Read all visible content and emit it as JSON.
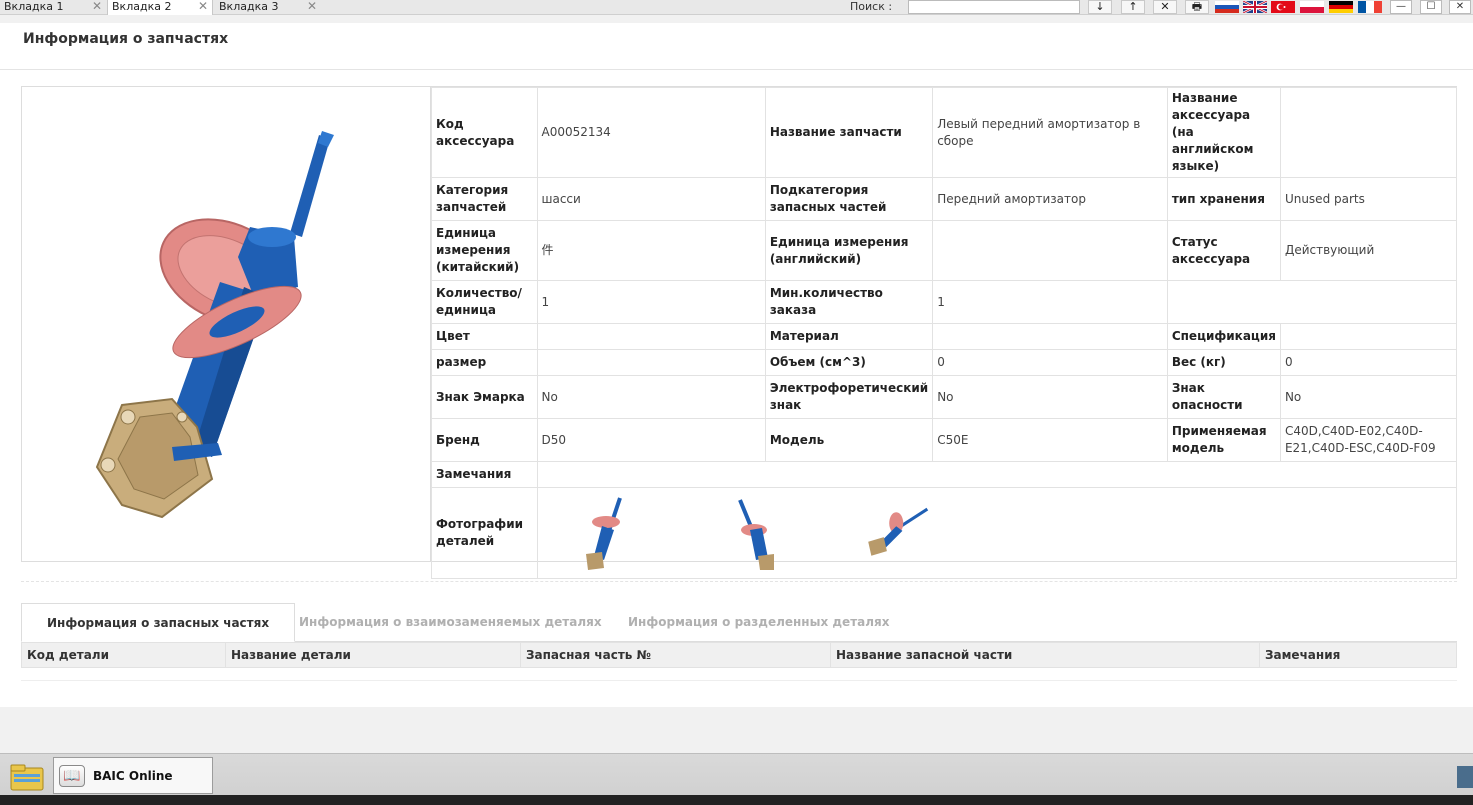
{
  "topbar": {
    "tabs": [
      {
        "label": "Вкладка 1"
      },
      {
        "label": "Вкладка 2"
      },
      {
        "label": "Вкладка 3"
      }
    ],
    "close_glyph": "✕",
    "search_label": "Поиск :",
    "search_value": "",
    "buttons": [
      "↓",
      "↑",
      "✕",
      "🖶"
    ],
    "flags": [
      "ru-flag",
      "gb-flag",
      "tr-flag",
      "pl-flag",
      "de-flag",
      "fr-flag"
    ],
    "window_buttons": [
      "—",
      "☐",
      "✕"
    ]
  },
  "page": {
    "title": "Информация о запчастях"
  },
  "info": {
    "code_label": "Код аксессуара",
    "code_value": "A00052134",
    "name_label": "Название запчасти",
    "name_value": "Левый передний амортизатор в сборе",
    "name_en_label": "Название аксессуара (на английском языке)",
    "name_en_value": "",
    "category_label": "Категория запчастей",
    "category_value": "шасси",
    "subcategory_label": "Подкатегория запасных частей",
    "subcategory_value": "Передний амортизатор",
    "storage_label": "тип хранения",
    "storage_value": "Unused parts",
    "unit_cn_label": "Единица измерения (китайский)",
    "unit_cn_value": "件",
    "unit_en_label": "Единица измерения (английский)",
    "unit_en_value": "",
    "status_label": "Статус аксессуара",
    "status_value": "Действующий",
    "qty_label": "Количество/ единица",
    "qty_value": "1",
    "minqty_label": "Мин.количество заказа",
    "minqty_value": "1",
    "color_label": "Цвет",
    "color_value": "",
    "material_label": "Материал",
    "material_value": "",
    "spec_label": "Спецификация",
    "spec_value": "",
    "size_label": "размер",
    "size_value": "",
    "volume_label": "Объем (см^3)",
    "volume_value": "0",
    "weight_label": "Вес (кг)",
    "weight_value": "0",
    "emark_label": "Знак Эмарка",
    "emark_value": "No",
    "electro_label": "Электрофоретический знак",
    "electro_value": "No",
    "danger_label": "Знак опасности",
    "danger_value": "No",
    "brand_label": "Бренд",
    "brand_value": "D50",
    "model_label": "Модель",
    "model_value": "C50E",
    "applicable_label": "Применяемая модель",
    "applicable_value": "C40D,C40D-E02,C40D-E21,C40D-ESC,C40D-F09",
    "remarks_label": "Замечания",
    "remarks_value": "",
    "photos_label": "Фотографии деталей"
  },
  "bottom_tabs": [
    {
      "label": "Информация о запасных частях",
      "active": true
    },
    {
      "label": "Информация о взаимозаменяемых деталях",
      "active": false
    },
    {
      "label": "Информация о разделенных деталях",
      "active": false
    }
  ],
  "grid": {
    "columns": [
      "Код детали",
      "Название детали",
      "Запасная часть №",
      "Название запасной части",
      "Замечания"
    ]
  },
  "taskbar": {
    "app_label": "BAIC Online"
  },
  "colors": {
    "part_blue": "#1f5fb4",
    "part_pink": "#e28a86",
    "part_brass": "#b89a6a"
  }
}
